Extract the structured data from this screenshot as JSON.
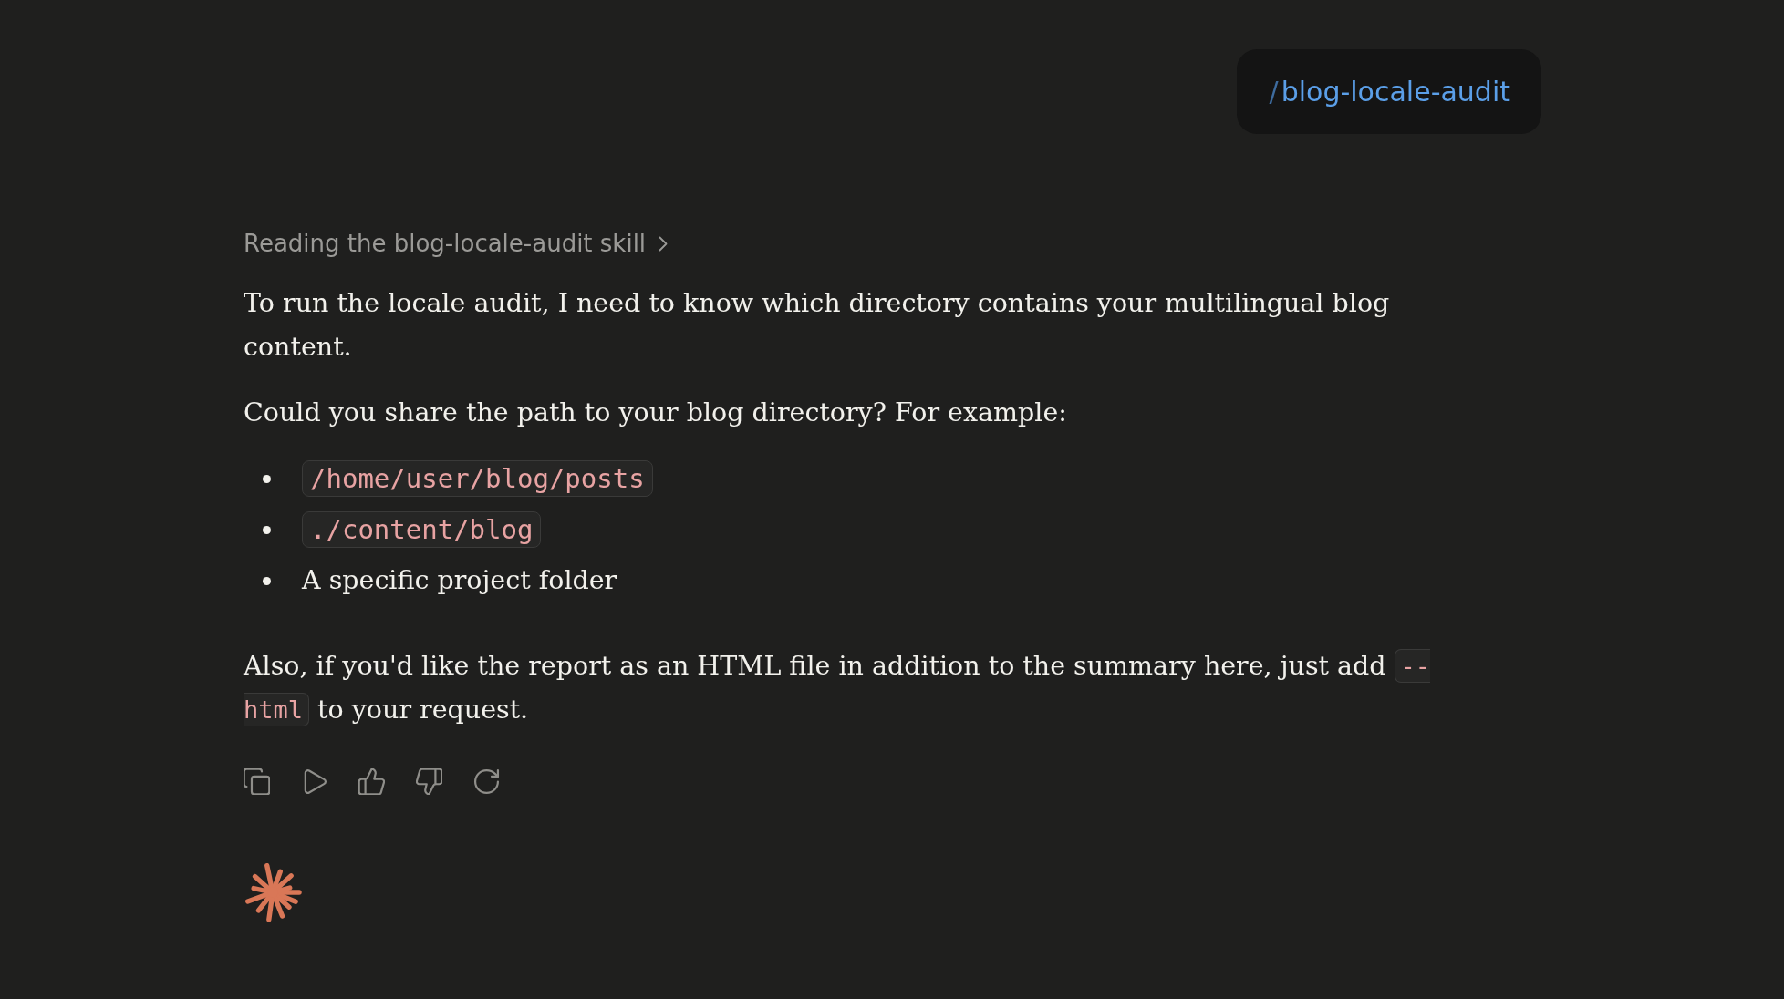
{
  "user_message": {
    "slash": "/",
    "command": "blog-locale-audit"
  },
  "assistant_message": {
    "tool_step": {
      "label": "Reading the blog-locale-audit skill",
      "expanded": false
    },
    "blocks": [
      {
        "kind": "paragraph",
        "parts": [
          {
            "kind": "text",
            "text": "To run the locale audit, I need to know which directory contains your multilingual blog content."
          }
        ]
      },
      {
        "kind": "paragraph",
        "parts": [
          {
            "kind": "text",
            "text": "Could you share the path to your blog directory? For example:"
          }
        ]
      },
      {
        "kind": "list",
        "items": [
          {
            "parts": [
              {
                "kind": "code",
                "text": "/home/user/blog/posts"
              }
            ]
          },
          {
            "parts": [
              {
                "kind": "code",
                "text": "./content/blog"
              }
            ]
          },
          {
            "parts": [
              {
                "kind": "text",
                "text": "A specific project folder"
              }
            ]
          }
        ]
      },
      {
        "kind": "paragraph",
        "parts": [
          {
            "kind": "text",
            "text": "Also, if you'd like the report as an HTML file in addition to the summary here, just add "
          },
          {
            "kind": "code",
            "text": "--html"
          },
          {
            "kind": "text",
            "text": " to your request."
          }
        ]
      }
    ]
  }
}
